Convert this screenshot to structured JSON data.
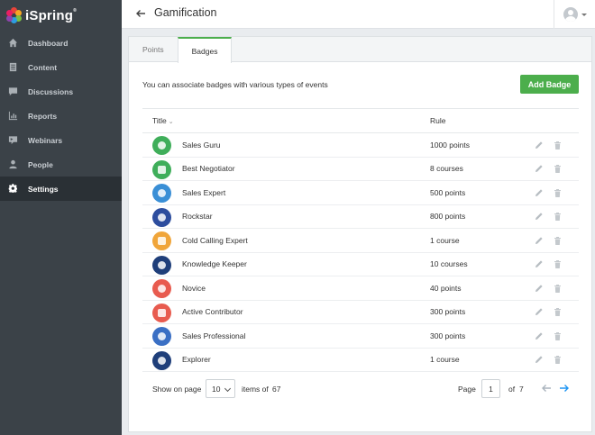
{
  "app": {
    "logo": "iSpring"
  },
  "sidebar": {
    "items": [
      {
        "label": "Dashboard",
        "icon": "home-icon"
      },
      {
        "label": "Content",
        "icon": "content-icon"
      },
      {
        "label": "Discussions",
        "icon": "chat-icon"
      },
      {
        "label": "Reports",
        "icon": "chart-icon"
      },
      {
        "label": "Webinars",
        "icon": "webinar-icon"
      },
      {
        "label": "People",
        "icon": "person-icon"
      },
      {
        "label": "Settings",
        "icon": "gear-icon",
        "active": true
      }
    ]
  },
  "header": {
    "title": "Gamification"
  },
  "tabs": [
    {
      "label": "Points"
    },
    {
      "label": "Badges",
      "active": true
    }
  ],
  "main": {
    "intro": "You can associate badges with various types of events",
    "add_button": "Add Badge"
  },
  "table": {
    "headers": {
      "title": "Title",
      "rule": "Rule"
    },
    "rows": [
      {
        "title": "Sales Guru",
        "rule": "1000 points",
        "color": "#3fae5a",
        "icon": "medal-icon"
      },
      {
        "title": "Best Negotiator",
        "rule": "8 courses",
        "color": "#3fae5a",
        "icon": "trophy-icon"
      },
      {
        "title": "Sales Expert",
        "rule": "500 points",
        "color": "#3a8fd6",
        "icon": "medal-icon"
      },
      {
        "title": "Rockstar",
        "rule": "800 points",
        "color": "#2d4d9e",
        "icon": "rocket-icon"
      },
      {
        "title": "Cold Calling Expert",
        "rule": "1 course",
        "color": "#f0a53a",
        "icon": "lion-icon"
      },
      {
        "title": "Knowledge Keeper",
        "rule": "10 courses",
        "color": "#1f3f7a",
        "icon": "book-icon"
      },
      {
        "title": "Novice",
        "rule": "40 points",
        "color": "#e85b4f",
        "icon": "thumbs-up-icon"
      },
      {
        "title": "Active Contributor",
        "rule": "300 points",
        "color": "#e85b4f",
        "icon": "diamond-icon"
      },
      {
        "title": "Sales Professional",
        "rule": "300 points",
        "color": "#3a6fc4",
        "icon": "bull-icon"
      },
      {
        "title": "Explorer",
        "rule": "1 course",
        "color": "#1f3f7a",
        "icon": "explorer-icon"
      }
    ]
  },
  "pager": {
    "show_label": "Show on page",
    "page_size": "10",
    "items_of_label": "items of",
    "total_items": "67",
    "page_label": "Page",
    "current_page": "1",
    "of_label": "of",
    "total_pages": "7"
  },
  "colors": {
    "accent": "#4cae4c",
    "sidebar": "#3b4248",
    "link": "#2196f3"
  }
}
